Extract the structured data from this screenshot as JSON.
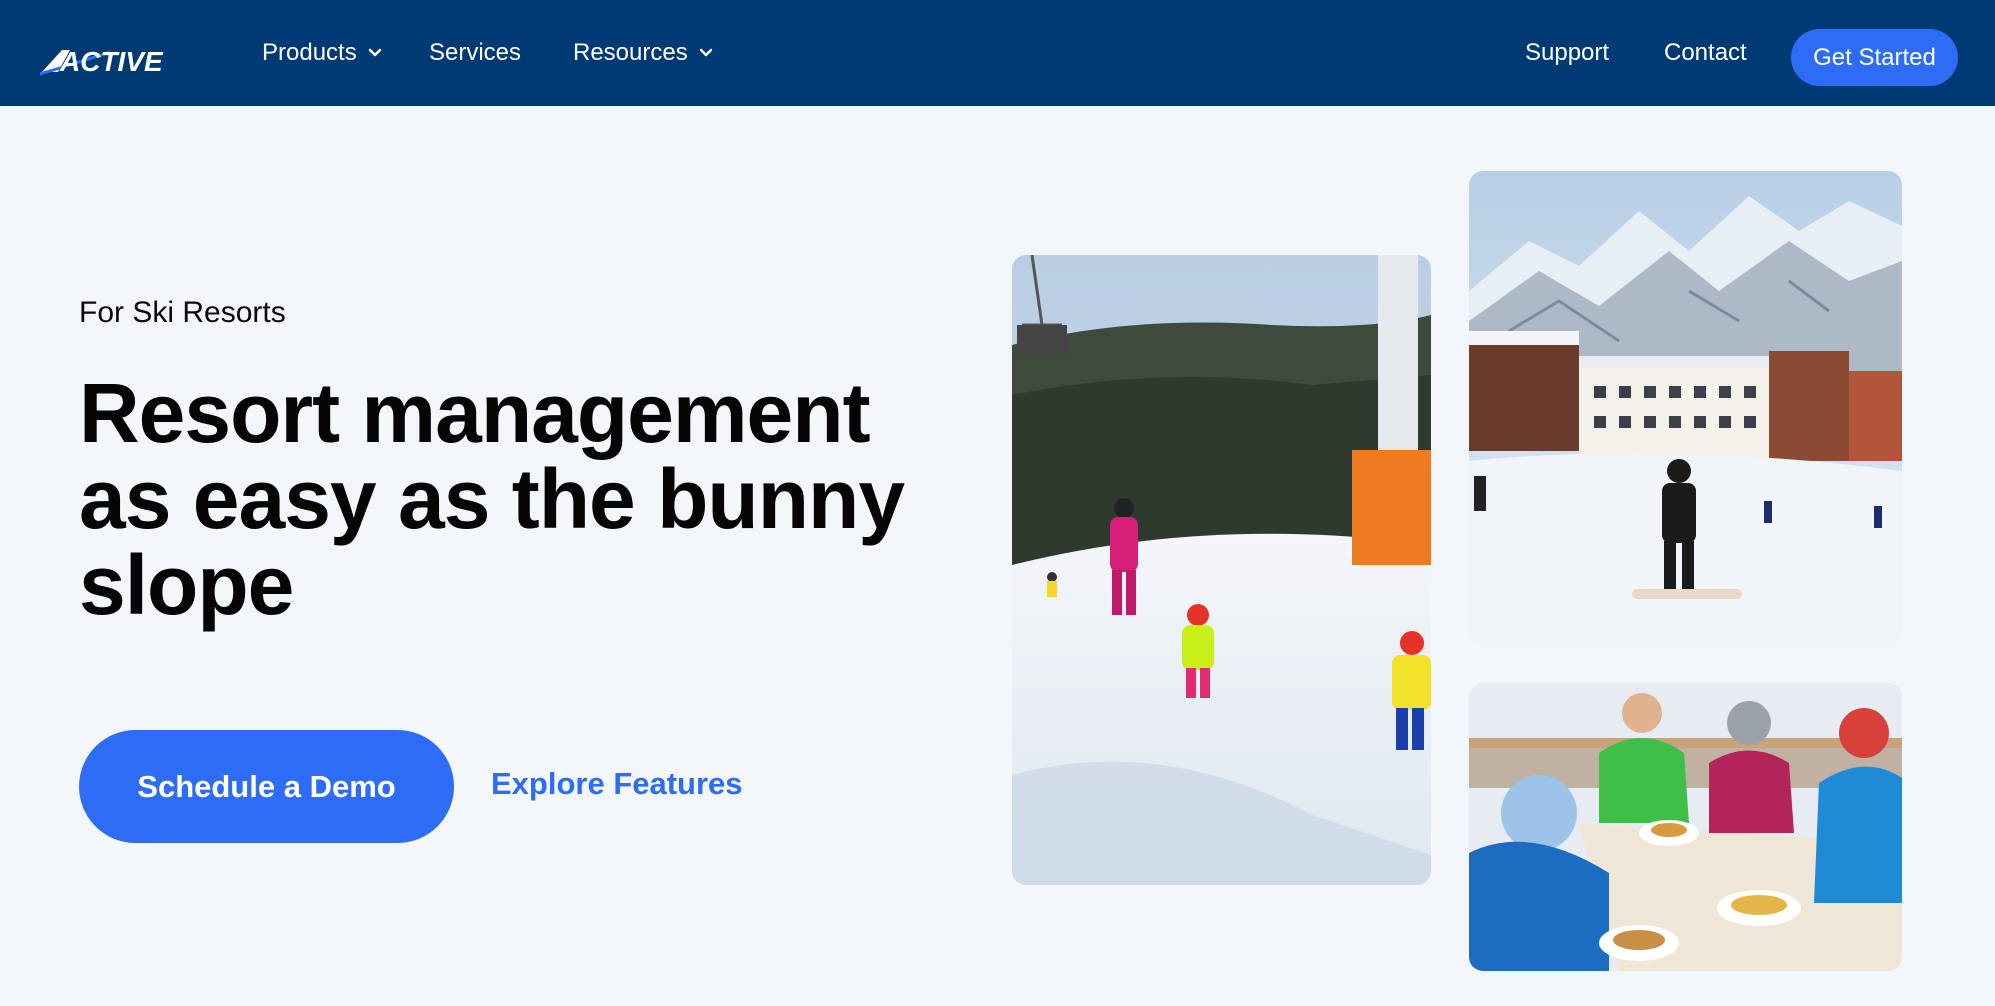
{
  "nav": {
    "logo_text": "ACTIVE",
    "items": [
      {
        "label": "Products",
        "has_dropdown": true
      },
      {
        "label": "Services",
        "has_dropdown": false
      },
      {
        "label": "Resources",
        "has_dropdown": true
      }
    ],
    "right_items": [
      {
        "label": "Support"
      },
      {
        "label": "Contact"
      }
    ],
    "cta_label": "Get Started"
  },
  "hero": {
    "eyebrow": "For Ski Resorts",
    "headline_lines": [
      "Resort management",
      "as easy as the bunny",
      "slope"
    ],
    "primary_cta": "Schedule a Demo",
    "secondary_cta": "Explore Features"
  },
  "images": [
    {
      "name": "kids-skiing-photo",
      "icon": "photo"
    },
    {
      "name": "ski-village-photo",
      "icon": "photo"
    },
    {
      "name": "outdoor-dining-photo",
      "icon": "photo"
    }
  ],
  "colors": {
    "nav_bg": "#003a75",
    "accent": "#2d6df6",
    "page_bg": "#f3f6fb"
  }
}
